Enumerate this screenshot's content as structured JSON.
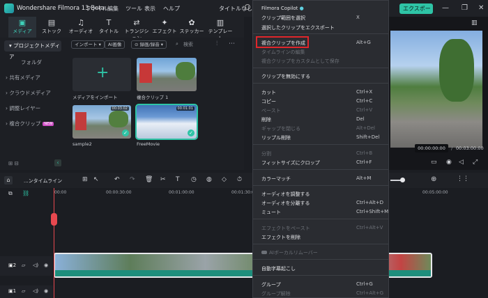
{
  "app": {
    "name": "Wondershare Filmora 13 Beta",
    "menus": [
      "ファイル",
      "編集",
      "ツール",
      "表示",
      "ヘルプ"
    ],
    "project_title": "タイトルなし",
    "export_label": "エクスポート"
  },
  "toolbar": {
    "tools": [
      "メディア",
      "ストック",
      "オーディオ",
      "タイトル",
      "トランジション",
      "エフェクト",
      "ステッカー",
      "テンプレート"
    ]
  },
  "sidebar": {
    "project_media": "プロジェクトメディア",
    "items": [
      "フォルダ",
      "共有メディア",
      "クラウドメディア",
      "調整レイヤー",
      "複合クリップ"
    ],
    "new_badge": "NEW"
  },
  "media": {
    "import_label": "インポート",
    "ai_label": "AI画像",
    "record_label": "録画/録音",
    "search_placeholder": "検索",
    "import_tile_label": "メディアをインポート",
    "clips": [
      {
        "name": "複合クリップ 1",
        "duration": ""
      },
      {
        "name": "sample2",
        "duration": "00:03:02"
      },
      {
        "name": "FreeMovie",
        "duration": "00:01:01"
      }
    ]
  },
  "preview": {
    "time_current": "00:00:00:00",
    "time_separator": "/",
    "time_total": "00:03:00:00"
  },
  "timeline": {
    "tab_label": "...ンタイムライン",
    "ruler": [
      "00:00",
      "00:00:30:00",
      "00:01:00:00",
      "00:01:30:00",
      "00:05:00:00"
    ]
  },
  "context_menu": {
    "items": [
      {
        "label": "Filmora Copilot",
        "shortcut": "",
        "disabled": false
      },
      {
        "label": "クリップ範囲を選択",
        "shortcut": "X",
        "disabled": false
      },
      {
        "label": "選択したクリップをエクスポート",
        "shortcut": "",
        "disabled": false
      },
      {
        "label": "複合クリップを作成",
        "shortcut": "Alt+G",
        "disabled": false,
        "highlighted": true
      },
      {
        "label": "タイムラインの編集",
        "shortcut": "",
        "disabled": true
      },
      {
        "label": "複合クリップをカスタムとして保存",
        "shortcut": "",
        "disabled": true
      },
      {
        "label": "クリップを無効にする",
        "shortcut": "",
        "disabled": false
      },
      {
        "label": "カット",
        "shortcut": "Ctrl+X",
        "disabled": false
      },
      {
        "label": "コピー",
        "shortcut": "Ctrl+C",
        "disabled": false
      },
      {
        "label": "ペースト",
        "shortcut": "Ctrl+V",
        "disabled": true
      },
      {
        "label": "削除",
        "shortcut": "Del",
        "disabled": false
      },
      {
        "label": "ギャップを閉じる",
        "shortcut": "Alt+Del",
        "disabled": true
      },
      {
        "label": "リップル削除",
        "shortcut": "Shift+Del",
        "disabled": false
      },
      {
        "label": "分割",
        "shortcut": "Ctrl+B",
        "disabled": true
      },
      {
        "label": "フィットサイズにクロップ",
        "shortcut": "Ctrl+F",
        "disabled": false
      },
      {
        "label": "カラーマッチ",
        "shortcut": "Alt+M",
        "disabled": false
      },
      {
        "label": "オーディオを調整する",
        "shortcut": "",
        "disabled": false
      },
      {
        "label": "オーディオを分離する",
        "shortcut": "Ctrl+Alt+D",
        "disabled": false
      },
      {
        "label": "ミュート",
        "shortcut": "Ctrl+Shift+M",
        "disabled": false
      },
      {
        "label": "エフェクトをペースト",
        "shortcut": "Ctrl+Alt+V",
        "disabled": true
      },
      {
        "label": "エフェクトを削除",
        "shortcut": "",
        "disabled": false
      },
      {
        "label": "AIボーカルリムーバー",
        "shortcut": "",
        "disabled": true
      },
      {
        "label": "自動字幕起こし",
        "shortcut": "",
        "disabled": false
      },
      {
        "label": "グループ",
        "shortcut": "Ctrl+G",
        "disabled": false
      },
      {
        "label": "グループ解除",
        "shortcut": "Ctrl+Alt+G",
        "disabled": true
      }
    ]
  },
  "colors": {
    "accent": "#2ec4a6",
    "highlight_border": "#e0262b",
    "playhead": "#e8484f"
  }
}
